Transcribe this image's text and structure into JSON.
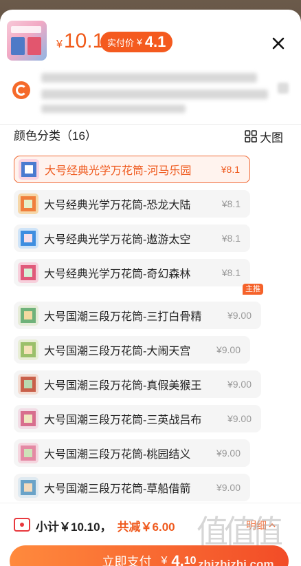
{
  "header": {
    "price_yen": "¥",
    "price": "10.1",
    "paid_label": "实付价",
    "paid_yen": "¥",
    "paid_price": "4.1"
  },
  "section": {
    "title": "颜色分类（16）",
    "big_view_label": "大图"
  },
  "options": [
    {
      "name": "大号经典光学万花筒-河马乐园",
      "price": "¥8.1",
      "selected": true
    },
    {
      "name": "大号经典光学万花筒-恐龙大陆",
      "price": "¥8.1"
    },
    {
      "name": "大号经典光学万花筒-遨游太空",
      "price": "¥8.1"
    },
    {
      "name": "大号经典光学万花筒-奇幻森林",
      "price": "¥8.1"
    },
    {
      "name": "大号国潮三段万花筒-三打白骨精",
      "price": "¥9.00",
      "tag": "主推"
    },
    {
      "name": "大号国潮三段万花筒-大闹天宫",
      "price": "¥9.00"
    },
    {
      "name": "大号国潮三段万花筒-真假美猴王",
      "price": "¥9.00"
    },
    {
      "name": "大号国潮三段万花筒-三英战吕布",
      "price": "¥9.00"
    },
    {
      "name": "大号国潮三段万花筒-桃园结义",
      "price": "¥9.00"
    },
    {
      "name": "大号国潮三段万花筒-草船借箭",
      "price": "¥9.00"
    }
  ],
  "footer": {
    "subtotal": "小计￥10.10，",
    "reduce": "共减￥6.00",
    "detail": "明细",
    "pay_label": "立即支付",
    "pay_yen": "¥",
    "pay_int": "4.",
    "pay_dec": "10"
  },
  "watermark": {
    "logo": "值值值",
    "text": "zhizhizhi.com"
  },
  "colors": {
    "accent": "#ef5a1e",
    "pay_gradient_start": "#ff8a3d",
    "pay_gradient_end": "#f24c27"
  }
}
